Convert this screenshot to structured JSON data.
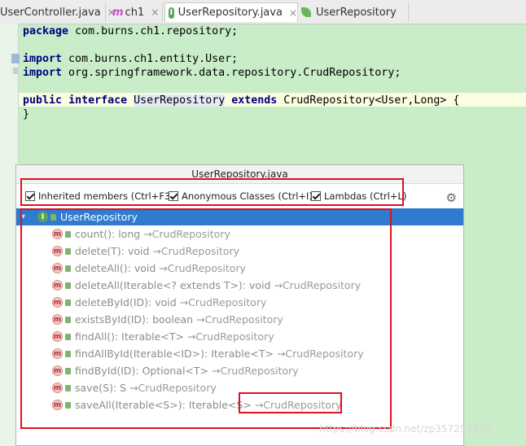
{
  "tabs": [
    {
      "label": "UserController.java",
      "icon": "class-icon"
    },
    {
      "label": "ch1",
      "icon": "module-icon"
    },
    {
      "label": "UserRepository.java",
      "icon": "interface-icon",
      "active": true
    },
    {
      "label": "UserRepository",
      "icon": "spring-leaf-icon"
    }
  ],
  "close_glyph": "×",
  "code": {
    "line1_kw": "package",
    "line1_rest": " com.burns.ch1.repository;",
    "line3_kw": "import",
    "line3_rest": " com.burns.ch1.entity.User;",
    "line4_kw": "import",
    "line4_rest": " org.springframework.data.repository.CrudRepository;",
    "line6_kw1": "public",
    "line6_kw2": "interface",
    "line6_name": "UserRepository",
    "line6_kw3": "extends",
    "line6_rest": " CrudRepository<User,Long> {",
    "line7": "}"
  },
  "popup": {
    "title": "UserRepository.java",
    "options": [
      {
        "label": "Inherited members (Ctrl+F3)",
        "checked": true
      },
      {
        "label": "Anonymous Classes (Ctrl+I)",
        "checked": true
      },
      {
        "label": "Lambdas (Ctrl+L)",
        "checked": true
      }
    ],
    "settings_icon": "gear-icon",
    "root": {
      "label": "UserRepository",
      "badge": "I"
    },
    "method_badge": "m",
    "methods": [
      {
        "sig": "count(): long",
        "from": "→CrudRepository"
      },
      {
        "sig": "delete(T): void",
        "from": "→CrudRepository"
      },
      {
        "sig": "deleteAll(): void",
        "from": "→CrudRepository"
      },
      {
        "sig": "deleteAll(Iterable<? extends T>): void",
        "from": "→CrudRepository"
      },
      {
        "sig": "deleteById(ID): void",
        "from": "→CrudRepository"
      },
      {
        "sig": "existsById(ID): boolean",
        "from": "→CrudRepository"
      },
      {
        "sig": "findAll(): Iterable<T>",
        "from": "→CrudRepository"
      },
      {
        "sig": "findAllById(Iterable<ID>): Iterable<T>",
        "from": "→CrudRepository"
      },
      {
        "sig": "findById(ID): Optional<T>",
        "from": "→CrudRepository"
      },
      {
        "sig": "save(S): S",
        "from": "→CrudRepository"
      },
      {
        "sig": "saveAll(Iterable<S>): Iterable<S>",
        "from": "→CrudRepository"
      }
    ]
  },
  "watermark": "https://blog.csdn.net/zp357252539",
  "colors": {
    "editor_bg": "#c9ecc9",
    "selection": "#2f7bcf",
    "highlight_box": "#e01020"
  }
}
